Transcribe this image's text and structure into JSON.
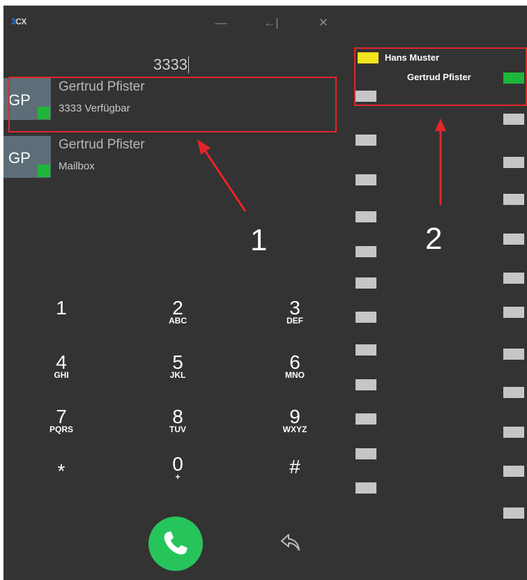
{
  "titlebar": {
    "logo": "3CX",
    "logo_main": "CX",
    "logo_accent": "3",
    "minimize_glyph": "—",
    "pin_glyph": "←|",
    "close_glyph": "✕"
  },
  "dialer": {
    "number": "3333",
    "results": [
      {
        "initials": "GP",
        "name": "Gertrud Pfister",
        "detail": "3333 Verfügbar",
        "presence_color": "#1fb53a"
      },
      {
        "initials": "GP",
        "name": "Gertrud Pfister",
        "detail": "Mailbox",
        "presence_color": "#1fb53a"
      }
    ],
    "keypad": [
      {
        "digit": "1",
        "letters": ""
      },
      {
        "digit": "2",
        "letters": "ABC"
      },
      {
        "digit": "3",
        "letters": "DEF"
      },
      {
        "digit": "4",
        "letters": "GHI"
      },
      {
        "digit": "5",
        "letters": "JKL"
      },
      {
        "digit": "6",
        "letters": "MNO"
      },
      {
        "digit": "7",
        "letters": "PQRS"
      },
      {
        "digit": "8",
        "letters": "TUV"
      },
      {
        "digit": "9",
        "letters": "WXYZ"
      },
      {
        "digit": "*",
        "letters": ""
      },
      {
        "digit": "0",
        "letters": "+"
      },
      {
        "digit": "#",
        "letters": ""
      }
    ],
    "call_color": "#27c45c"
  },
  "blf_panel": {
    "first": {
      "name": "Hans Muster",
      "status_color": "#f2e41d"
    },
    "second": {
      "name": "Gertrud Pfister",
      "status_color": "#1fb53a"
    }
  },
  "annotations": {
    "label_1": "1",
    "label_2": "2",
    "color": "#e3262a"
  }
}
